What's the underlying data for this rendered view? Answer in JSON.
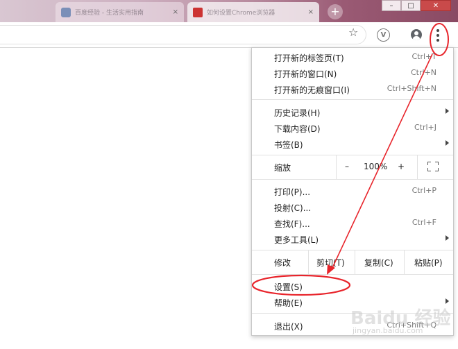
{
  "window": {
    "tabs": [
      {
        "title": "百度经验 - 生活实用指南",
        "close": "×"
      },
      {
        "title": "如何设置Chrome浏览器",
        "close": "×"
      }
    ],
    "new_tab": "+",
    "controls": {
      "minimize": "–",
      "maximize": "□",
      "close": "✕"
    }
  },
  "toolbar": {
    "star_icon": "star-icon",
    "extension_letter": "V",
    "account_icon": "account-icon",
    "menu_icon": "vertical-dots-icon"
  },
  "menu": {
    "group1": [
      {
        "label": "打开新的标签页(T)",
        "shortcut": "Ctrl+T"
      },
      {
        "label": "打开新的窗口(N)",
        "shortcut": "Ctrl+N"
      },
      {
        "label": "打开新的无痕窗口(I)",
        "shortcut": "Ctrl+Shift+N"
      }
    ],
    "group2": [
      {
        "label": "历史记录(H)",
        "has_submenu": true
      },
      {
        "label": "下载内容(D)",
        "shortcut": "Ctrl+J"
      },
      {
        "label": "书签(B)",
        "has_submenu": true
      }
    ],
    "zoom": {
      "label": "缩放",
      "minus": "–",
      "value": "100%",
      "plus": "+"
    },
    "group3": [
      {
        "label": "打印(P)...",
        "shortcut": "Ctrl+P"
      },
      {
        "label": "投射(C)..."
      },
      {
        "label": "查找(F)...",
        "shortcut": "Ctrl+F"
      },
      {
        "label": "更多工具(L)",
        "has_submenu": true
      }
    ],
    "edit": {
      "label": "修改",
      "cut": "剪切(T)",
      "copy": "复制(C)",
      "paste": "粘贴(P)"
    },
    "group4": [
      {
        "label": "设置(S)"
      },
      {
        "label": "帮助(E)",
        "has_submenu": true
      }
    ],
    "exit": {
      "label": "退出(X)",
      "shortcut": "Ctrl+Shift+Q"
    }
  },
  "annotations": {
    "highlight_color": "#e8242b"
  },
  "watermark": {
    "text": "Baidu 经验",
    "sub": "jingyan.baidu.com"
  }
}
